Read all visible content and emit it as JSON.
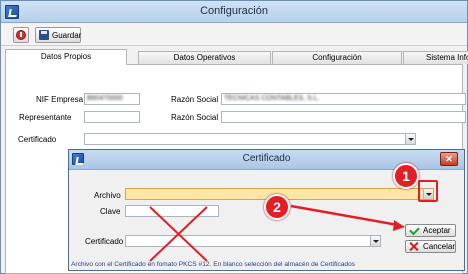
{
  "window": {
    "title": "Configuración"
  },
  "toolbar": {
    "save_label": "Guardar"
  },
  "tabs": [
    {
      "label": "Datos Propios"
    },
    {
      "label": "Datos Operativos"
    },
    {
      "label": "Configuración"
    },
    {
      "label": "Sistema Info"
    }
  ],
  "form": {
    "nif_label": "NIF Empresa",
    "nif_value": "B60470000",
    "razon_social_label": "Razón Social",
    "razon_social_value": "TECNICAS CONTABLES, S.L.",
    "representante_label": "Representante",
    "representante_value": "",
    "razon_social_2_label": "Razón Social",
    "razon_social_2_value": "",
    "certificado_label": "Certificado",
    "certificado_value": ""
  },
  "dialog": {
    "title": "Certificado",
    "archivo_label": "Archivo",
    "archivo_value": "",
    "clave_label": "Clave",
    "clave_value": "",
    "certificado_label": "Certificado",
    "certificado_value": "",
    "accept_label": "Aceptar",
    "cancel_label": "Cancelar",
    "status_text": "Archivo con el Certificado en fomato PKCS #12. En blanco selección del almacén de Certificados",
    "close_glyph": "✕"
  },
  "annotations": {
    "step1": "1",
    "step2": "2",
    "color": "#e31e24"
  }
}
